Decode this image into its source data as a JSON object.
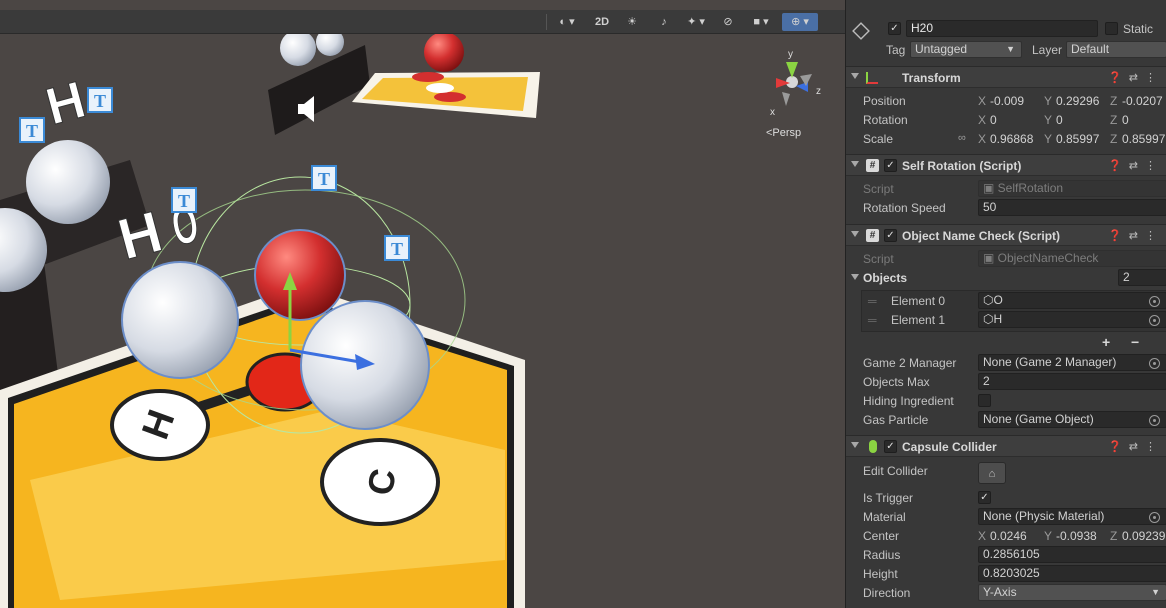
{
  "toolbar": {
    "shading_icon": "shading-mode-icon",
    "mode_2d": "2D",
    "lighting_icon": "lighting-icon",
    "audio_icon": "audio-icon",
    "effects_icon": "effects-icon",
    "hidden_icon": "visibility-icon",
    "camera_icon": "camera-icon",
    "gizmos_icon": "gizmos-icon"
  },
  "scene": {
    "projection_label": "<Persp",
    "gizmo_axes": {
      "y": "y",
      "x": "x",
      "z": "z"
    },
    "labels": {
      "h_large": "H",
      "o_large": "O",
      "t_badge": "T",
      "card_h": "H",
      "card_c": "C"
    }
  },
  "header": {
    "object_name": "H20",
    "static_label": "Static",
    "tag_label": "Tag",
    "tag_value": "Untagged",
    "layer_label": "Layer",
    "layer_value": "Default"
  },
  "transform": {
    "title": "Transform",
    "position": {
      "label": "Position",
      "x": "-0.009",
      "y": "0.29296",
      "z": "-0.0207"
    },
    "rotation": {
      "label": "Rotation",
      "x": "0",
      "y": "0",
      "z": "0"
    },
    "scale": {
      "label": "Scale",
      "x": "0.96868",
      "y": "0.85997",
      "z": "0.85997"
    }
  },
  "self_rotation": {
    "title": "Self Rotation (Script)",
    "script_label": "Script",
    "script_value": "SelfRotation",
    "speed_label": "Rotation Speed",
    "speed_value": "50"
  },
  "name_check": {
    "title": "Object Name Check (Script)",
    "script_label": "Script",
    "script_value": "ObjectNameCheck",
    "objects_label": "Objects",
    "objects_count": "2",
    "elements": [
      {
        "label": "Element 0",
        "value": "O"
      },
      {
        "label": "Element 1",
        "value": "H"
      }
    ],
    "add": "+",
    "remove": "−",
    "manager_label": "Game 2 Manager",
    "manager_value": "None (Game 2 Manager)",
    "max_label": "Objects Max",
    "max_value": "2",
    "hiding_label": "Hiding Ingredient",
    "gas_label": "Gas Particle",
    "gas_value": "None (Game Object)"
  },
  "capsule": {
    "title": "Capsule Collider",
    "edit_label": "Edit Collider",
    "trigger_label": "Is Trigger",
    "material_label": "Material",
    "material_value": "None (Physic Material)",
    "center_label": "Center",
    "center": {
      "x": "0.0246",
      "y": "-0.0938",
      "z": "0.09239"
    },
    "radius_label": "Radius",
    "radius_value": "0.2856105",
    "height_label": "Height",
    "height_value": "0.8203025",
    "direction_label": "Direction",
    "direction_value": "Y-Axis"
  },
  "axis_letters": {
    "x": "X",
    "y": "Y",
    "z": "Z"
  }
}
